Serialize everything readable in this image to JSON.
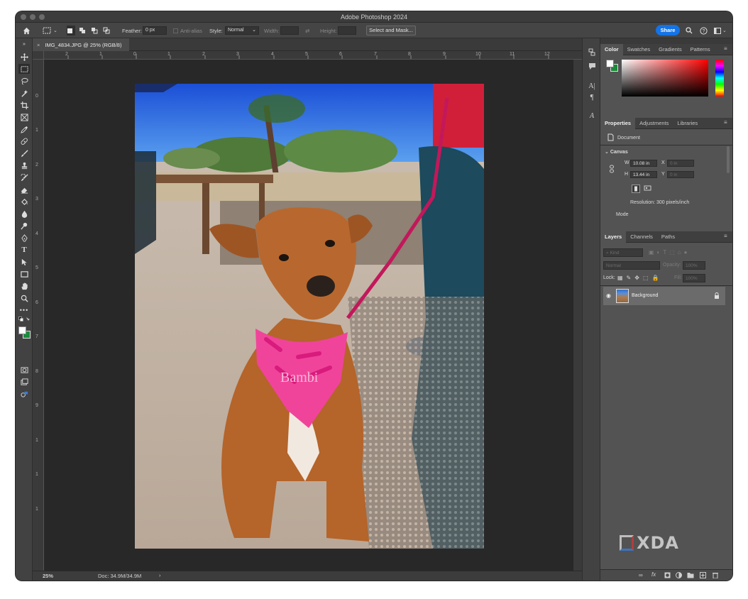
{
  "window": {
    "title": "Adobe Photoshop 2024"
  },
  "options_bar": {
    "feather_label": "Feather:",
    "feather_value": "0 px",
    "antialias_label": "Anti-alias",
    "style_label": "Style:",
    "style_value": "Normal",
    "width_label": "Width:",
    "height_label": "Height:",
    "select_mask_label": "Select and Mask...",
    "share_label": "Share"
  },
  "document": {
    "tab_label": "IMG_4834.JPG @ 25% (RGB/8)",
    "zoom": "25%",
    "doc_size": "Doc: 34.9M/34.9M",
    "image_text": "Bambi"
  },
  "rulers": {
    "top": [
      "2",
      "1",
      "0",
      "1",
      "2",
      "3",
      "4",
      "5",
      "6",
      "7",
      "8",
      "9",
      "10",
      "11",
      "12"
    ],
    "left": [
      "0",
      "1",
      "2",
      "3",
      "4",
      "5",
      "6",
      "7",
      "8",
      "9",
      "1",
      "1",
      "1"
    ]
  },
  "color_panel": {
    "tabs": [
      "Color",
      "Swatches",
      "Gradients",
      "Patterns"
    ],
    "fg_color": "#ffffff",
    "bg_color": "#1a8c3a"
  },
  "properties_panel": {
    "tabs": [
      "Properties",
      "Adjustments",
      "Libraries"
    ],
    "type_label": "Document",
    "section_label": "Canvas",
    "w_label": "W",
    "w_value": "10.08 in",
    "h_label": "H",
    "h_value": "13.44 in",
    "x_label": "X",
    "x_value": "0 in",
    "y_label": "Y",
    "y_value": "0 in",
    "resolution": "Resolution: 300 pixels/inch",
    "mode_label": "Mode"
  },
  "layers_panel": {
    "tabs": [
      "Layers",
      "Channels",
      "Paths"
    ],
    "filter_placeholder": "Kind",
    "blend_mode": "Normal",
    "opacity_label": "Opacity:",
    "opacity_value": "100%",
    "lock_label": "Lock:",
    "fill_label": "Fill:",
    "fill_value": "100%",
    "layers": [
      {
        "name": "Background",
        "visible": true,
        "locked": true
      }
    ]
  },
  "watermark": "XDA"
}
